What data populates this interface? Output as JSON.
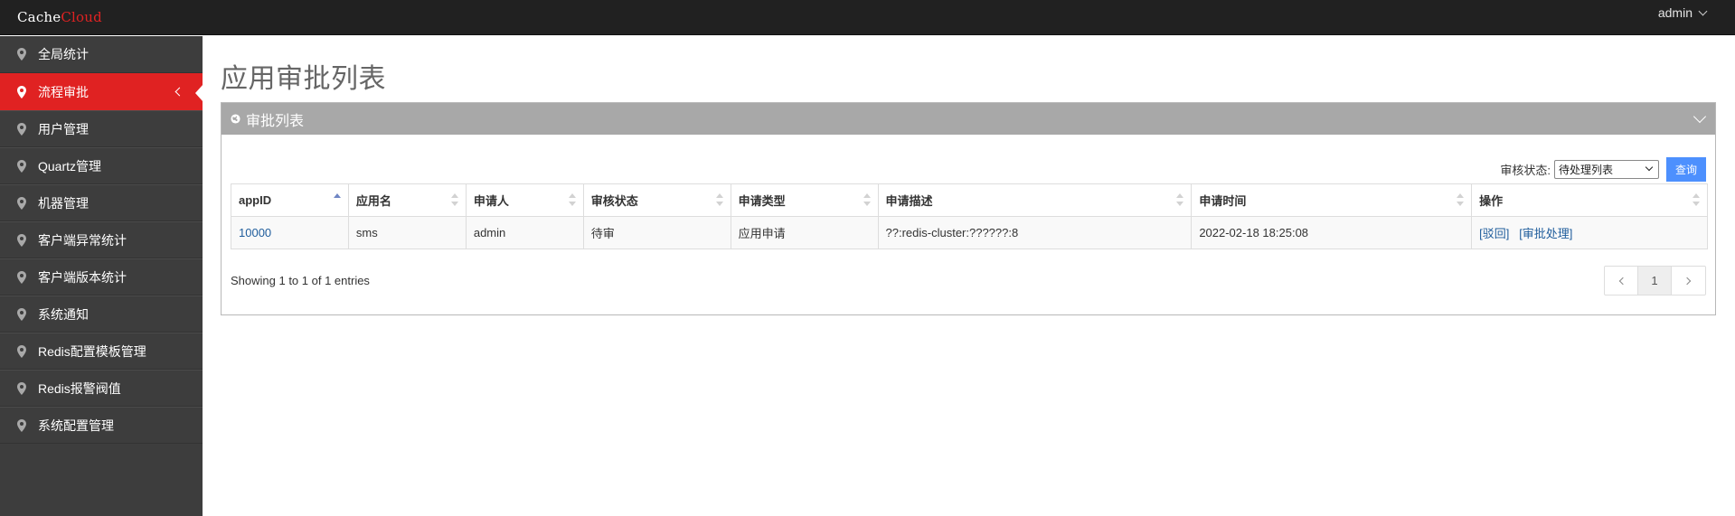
{
  "header": {
    "brand_part1": "Cache",
    "brand_part2": "Cloud",
    "user": "admin"
  },
  "sidebar": {
    "items": [
      {
        "label": "全局统计"
      },
      {
        "label": "流程审批",
        "active": true
      },
      {
        "label": "用户管理"
      },
      {
        "label": "Quartz管理"
      },
      {
        "label": "机器管理"
      },
      {
        "label": "客户端异常统计"
      },
      {
        "label": "客户端版本统计"
      },
      {
        "label": "系统通知"
      },
      {
        "label": "Redis配置模板管理"
      },
      {
        "label": "Redis报警阀值"
      },
      {
        "label": "系统配置管理"
      }
    ]
  },
  "main": {
    "page_title": "应用审批列表",
    "portlet_title": "审批列表",
    "filter": {
      "label": "审核状态:",
      "selected": "待处理列表",
      "button": "查询"
    },
    "table": {
      "columns": [
        "appID",
        "应用名",
        "申请人",
        "审核状态",
        "申请类型",
        "申请描述",
        "申请时间",
        "操作"
      ],
      "rows": [
        {
          "appid": "10000",
          "app_name": "sms",
          "applicant": "admin",
          "status": "待审",
          "type": "应用申请",
          "desc": "??:redis-cluster:??????:8",
          "time": "2022-02-18 18:25:08",
          "action_reject": "[驳回]",
          "action_approve": "[审批处理]"
        }
      ]
    },
    "info": "Showing 1 to 1 of 1 entries",
    "pager": {
      "current": "1"
    }
  },
  "colors": {
    "topbar": "#212121",
    "sidebar": "#3d3d3d",
    "active": "#e02222",
    "portlet_header": "#a8a8a8",
    "button": "#4d90fe",
    "link": "#1f5d9c"
  },
  "icons": {
    "sidebar": "map-marker-icon",
    "portlet": "globe-icon",
    "sort": "sort-arrows-icon"
  }
}
